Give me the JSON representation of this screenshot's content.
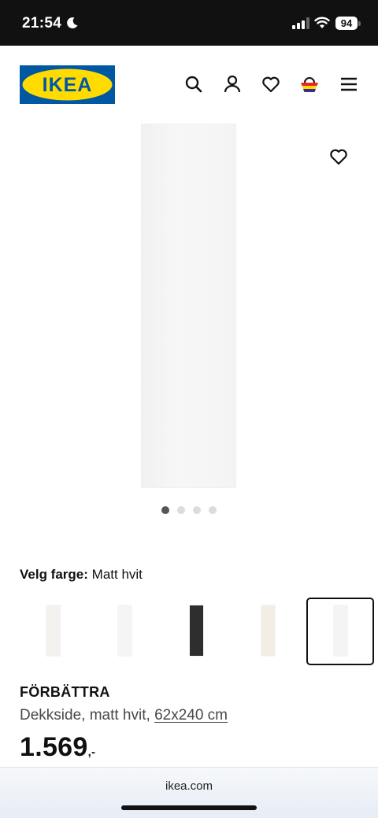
{
  "status_bar": {
    "time": "21:54",
    "battery": "94",
    "icons": [
      "moon-icon",
      "signal-icon",
      "wifi-icon",
      "battery-icon"
    ]
  },
  "header": {
    "logo_text": "IKEA",
    "icons": [
      "search-icon",
      "account-icon",
      "heart-icon",
      "basket-icon",
      "menu-icon"
    ],
    "colors": {
      "logo_blue": "#0058a3",
      "logo_yellow": "#ffdb00"
    }
  },
  "gallery": {
    "image_count": 4,
    "active_index": 0
  },
  "color_selector": {
    "label": "Velg farge:",
    "value": "Matt hvit",
    "swatches": [
      {
        "color": "#f3f2ee",
        "selected": false
      },
      {
        "color": "#f5f5f5",
        "selected": false
      },
      {
        "color": "#2e2e2e",
        "selected": false
      },
      {
        "color": "#f2eee6",
        "selected": false
      },
      {
        "color": "#f4f4f4",
        "selected": true
      }
    ]
  },
  "product": {
    "name": "FÖRBÄTTRA",
    "description": "Dekkside, matt hvit,",
    "size_link": "62x240 cm",
    "price": "1.569",
    "price_suffix": ",-"
  },
  "browser": {
    "url": "ikea.com"
  }
}
